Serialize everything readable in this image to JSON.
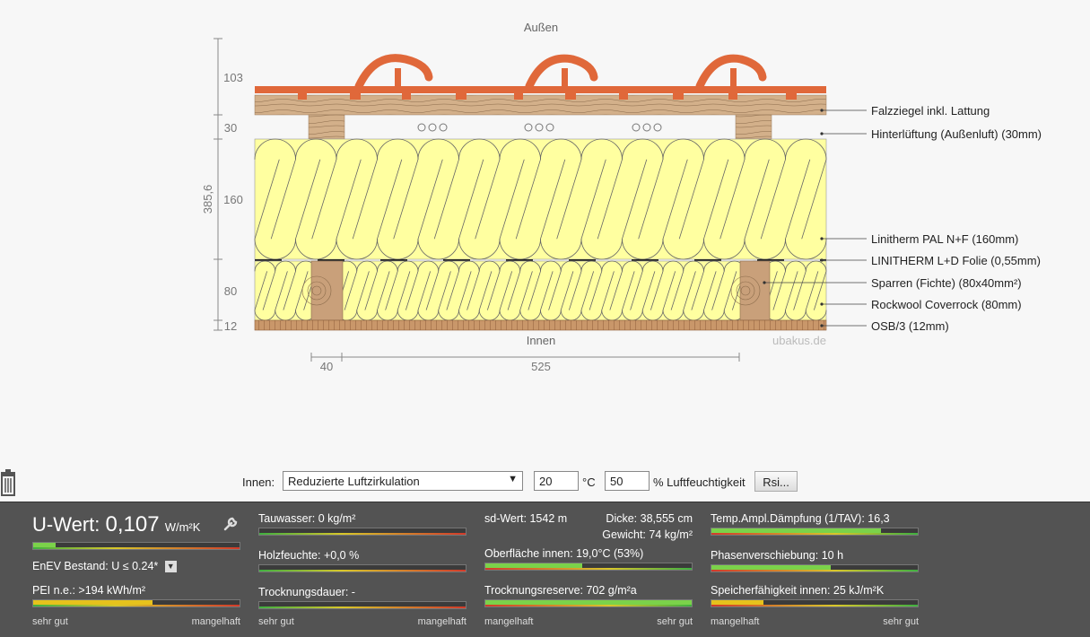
{
  "diagram": {
    "outside_label": "Außen",
    "inside_label": "Innen",
    "watermark": "ubakus.de",
    "total_thickness": "385,6",
    "dims_left": [
      "103",
      "30",
      "160",
      "80",
      "12"
    ],
    "dims_bottom": [
      "40",
      "525"
    ],
    "layers": [
      {
        "label": "Falzziegel inkl. Lattung"
      },
      {
        "label": "Hinterlüftung (Außenluft) (30mm)"
      },
      {
        "label": "Linitherm PAL N+F (160mm)"
      },
      {
        "label": "LINITHERM L+D Folie (0,55mm)"
      },
      {
        "label": "Sparren (Fichte) (80x40mm²)"
      },
      {
        "label": "Rockwool Coverrock (80mm)"
      },
      {
        "label": "OSB/3 (12mm)"
      }
    ],
    "colors": {
      "tile": "#e0683a",
      "wood": "#c8a27c",
      "insulation": "#ffffa0",
      "osb": "#c9976a"
    }
  },
  "controls": {
    "inside_label": "Innen:",
    "climate_select": "Reduzierte Luftzirkulation",
    "temperature": "20",
    "temperature_unit": "°C",
    "humidity": "50",
    "humidity_unit": "% Luftfeuchtigkeit",
    "rsi_button": "Rsi..."
  },
  "results": {
    "u_wert_label": "U-Wert:",
    "u_wert_value": "0,107",
    "u_wert_unit": "W/m²K",
    "u_wert_level": 0.11,
    "enev_text": "EnEV Bestand: U ≤ 0.24*",
    "pei_text": "PEI n.e.: >194 kWh/m²",
    "pei_level": 0.58,
    "tauwasser_text": "Tauwasser: 0 kg/m²",
    "holzfeuchte_text": "Holzfeuchte: +0,0 %",
    "trocknungsdauer_text": "Trocknungsdauer: -",
    "sd_wert_text": "sd-Wert: 1542 m",
    "dicke_text": "Dicke: 38,555 cm",
    "gewicht_text": "Gewicht: 74 kg/m²",
    "oberflaeche_text": "Oberfläche innen: 19,0°C (53%)",
    "oberflaeche_level": 0.47,
    "trocknungsreserve_text": "Trocknungsreserve: 702 g/m²a",
    "trocknungsreserve_level": 1.0,
    "temp_ampl_text": "Temp.Ampl.Dämpfung (1/TAV): 16,3",
    "temp_ampl_level": 0.82,
    "phasen_text": "Phasenverschiebung: 10 h",
    "phasen_level": 0.58,
    "speicher_text": "Speicherfähigkeit innen: 25 kJ/m²K",
    "speicher_level": 0.25,
    "scale_good": "sehr gut",
    "scale_bad": "mangelhaft",
    "colors": {
      "good": "#7bd24a",
      "yellow": "#e6c21c"
    }
  }
}
